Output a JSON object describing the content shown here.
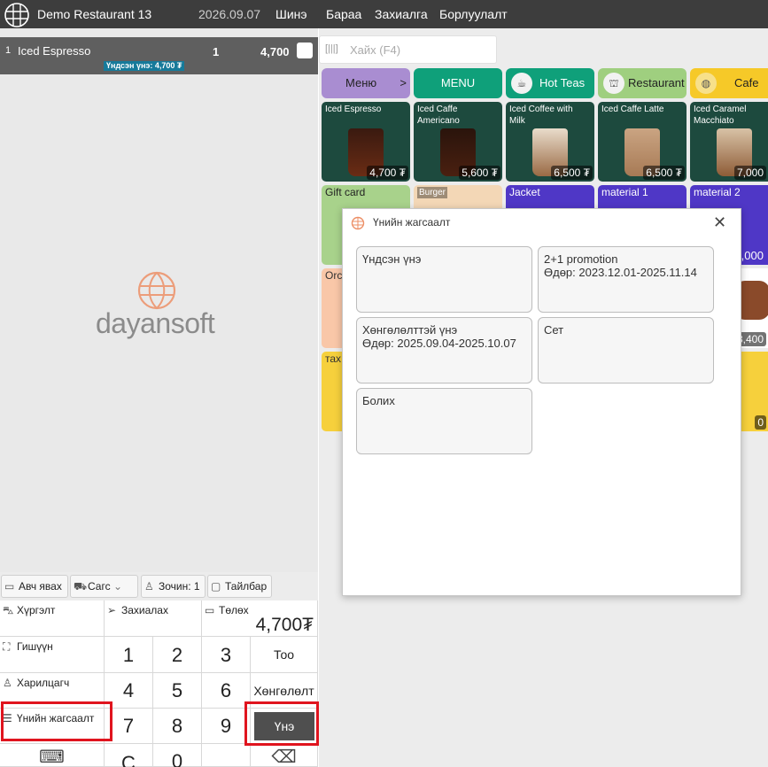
{
  "topbar": {
    "app_title": "Demo Restaurant 13",
    "date": "2026.09.07",
    "nav": [
      "Шинэ",
      "Бараа",
      "Захиалга",
      "Борлуулалт"
    ]
  },
  "cart": {
    "rows": [
      {
        "index": "1",
        "name": "Iced Espresso",
        "badge": "Үндсэн үнэ: 4,700 ₮",
        "qty": "1",
        "amount": "4,700"
      }
    ]
  },
  "brand": {
    "name": "dayansoft"
  },
  "chips": [
    "Авч явах",
    "Сагс",
    "Зочин: 1",
    "Тайлбар"
  ],
  "keypad": {
    "delivery": "Хүргэлт",
    "order": "Захиалах",
    "pay_label": "Төлөх",
    "pay_amount": "4,700₮",
    "member": "Гишүүн",
    "customer": "Харилцагч",
    "price_list": "Үнийн жагсаалт",
    "digits": [
      "1",
      "2",
      "3",
      "4",
      "5",
      "6",
      "7",
      "8",
      "9",
      "C",
      "0",
      "."
    ],
    "qty": "Тоо",
    "discount": "Хөнгөлөлт",
    "price": "Үнэ"
  },
  "search": {
    "placeholder": "Хайх (F4)"
  },
  "categories": [
    {
      "label": "Меню",
      "suffix": ">",
      "color": "#a98dd1"
    },
    {
      "label": "MENU",
      "color": "#0fa07a"
    },
    {
      "label": "Hot Teas",
      "color": "#0fa07a"
    },
    {
      "label": "Restaurant",
      "color": "#9fcf7f"
    },
    {
      "label": "Cafe",
      "color": "#f6c928"
    }
  ],
  "products": [
    {
      "name": "Iced Espresso",
      "price": "4,700 ₮"
    },
    {
      "name": "Iced Caffe Americano",
      "price": "5,600 ₮"
    },
    {
      "name": "Iced Coffee with Milk",
      "price": "6,500 ₮"
    },
    {
      "name": "Iced Caffe Latte",
      "price": "6,500 ₮"
    },
    {
      "name": "Iced Caramel Macchiato",
      "price": "7,000"
    }
  ],
  "row2": [
    {
      "name": "Gift card",
      "color": "#a8d28b"
    },
    {
      "name": "Burger",
      "color": "#f3d7b6"
    },
    {
      "name": "Jacket",
      "color": "#4f37c6"
    },
    {
      "name": "material 1",
      "color": "#4f37c6"
    },
    {
      "name": "material 2",
      "color": "#4f37c6",
      "price": "5,000"
    }
  ],
  "row3": [
    {
      "name": "Orc",
      "color": "#f9c7a8"
    },
    {
      "name": "",
      "color": "#ffffff",
      "price": "8,400"
    }
  ],
  "row4": [
    {
      "name": "тах",
      "color": "#f6d03c"
    },
    {
      "name": "",
      "color": "#f6d03c",
      "price": "0"
    }
  ],
  "modal": {
    "title": "Үнийн жагсаалт",
    "options": [
      {
        "title": "Үндсэн үнэ",
        "sub": ""
      },
      {
        "title": "2+1 promotion",
        "sub": "Өдөр: 2023.12.01-2025.11.14"
      },
      {
        "title": "Хөнгөлөлттэй үнэ",
        "sub": "Өдөр: 2025.09.04-2025.10.07"
      },
      {
        "title": "Сет",
        "sub": ""
      },
      {
        "title": "Болих",
        "sub": ""
      }
    ]
  }
}
